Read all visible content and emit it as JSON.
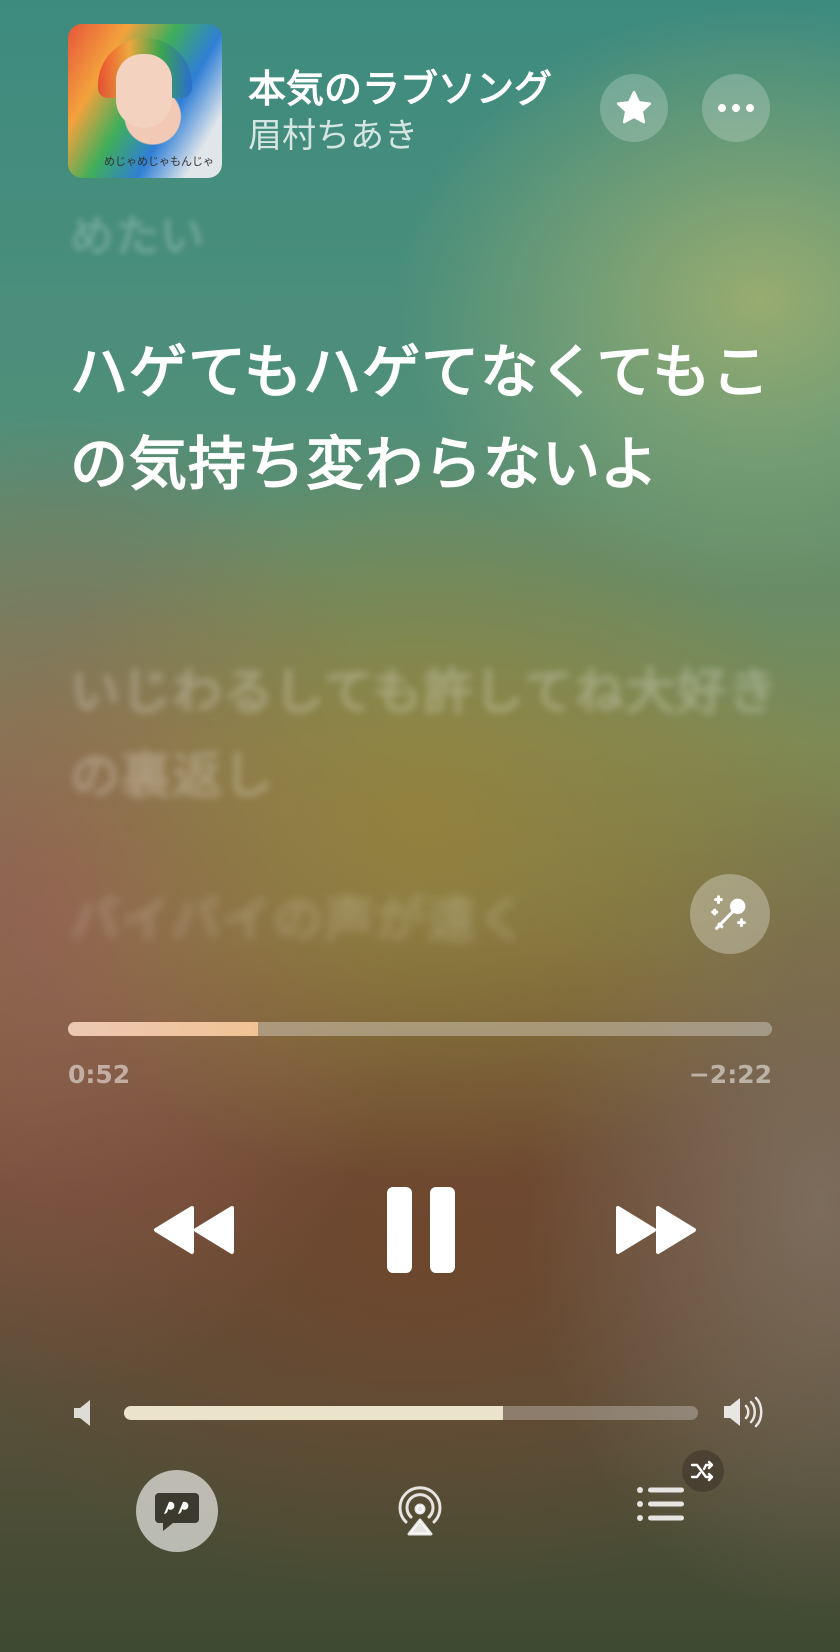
{
  "now_playing": {
    "title": "本気のラブソング",
    "artist": "眉村ちあき",
    "artwork_text": "めじゃめじゃもんじゃ",
    "artwork_icon": "album-artwork"
  },
  "header": {
    "favorite_icon": "star-icon",
    "more_icon": "ellipsis-icon"
  },
  "lyrics": {
    "previous": "めたい",
    "current": "ハゲてもハゲてなくてもこの気持ち変わらないよ",
    "next": "いじわるしても許してね大好きの裏返し",
    "next2": "バイバイの声が遠く"
  },
  "sing_button_icon": "microphone-sparkle-icon",
  "playback": {
    "elapsed": "0:52",
    "remaining": "−2:22",
    "progress": 0.27
  },
  "controls": {
    "rewind_icon": "rewind-icon",
    "pause_icon": "pause-icon",
    "forward_icon": "fast-forward-icon"
  },
  "volume": {
    "level": 0.66,
    "low_icon": "speaker-low-icon",
    "high_icon": "speaker-high-icon"
  },
  "bottom_bar": {
    "lyrics_icon": "quote-bubble-icon",
    "airplay_icon": "airplay-audio-icon",
    "queue_icon": "list-icon",
    "shuffle_icon": "shuffle-icon"
  },
  "colors": {
    "progress_fill": "#ecc8b4",
    "volume_fill": "#ece3cb"
  }
}
